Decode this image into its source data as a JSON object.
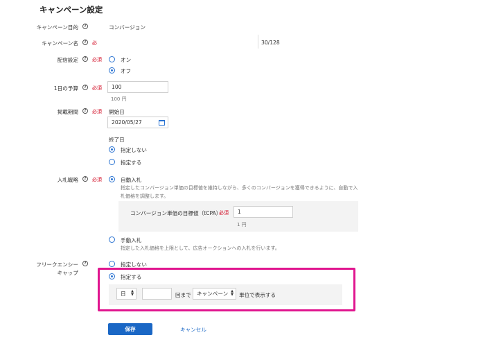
{
  "page_title": "キャンペーン設定",
  "required_label": "必須",
  "fields": {
    "objective": {
      "label": "キャンペーン目的",
      "value": "コンバージョン"
    },
    "name": {
      "label": "キャンペーン名",
      "required": "必",
      "counter": "30/128"
    },
    "delivery": {
      "label": "配信設定",
      "options": [
        "オン",
        "オフ"
      ],
      "selected": "オフ"
    },
    "daily_budget": {
      "label": "1日の予算",
      "value": "100",
      "hint": "100 円"
    },
    "period": {
      "label": "掲載期間",
      "start_label": "開始日",
      "start_value": "2020/05/27",
      "end_label": "終了日",
      "end_options": [
        "指定しない",
        "指定する"
      ],
      "end_selected": "指定しない"
    },
    "bidding": {
      "label": "入札戦略",
      "auto_label": "自動入札",
      "auto_desc_line1": "指定したコンバージョン単価の目標値を維持しながら、多くのコンバージョンを獲得できるように、自動で入",
      "auto_desc_line2": "札価格を調整します。",
      "tcpa_label": "コンバージョン単価の目標値（tCPA）",
      "tcpa_value": "1",
      "tcpa_hint": "1 円",
      "manual_label": "手動入札",
      "manual_desc": "指定した入札価格を上限として、広告オークションへの入札を行います。"
    },
    "frequency_cap": {
      "label_line1": "フリークエンシー",
      "label_line2": "キャップ",
      "options": [
        "指定しない",
        "指定する"
      ],
      "selected": "指定する",
      "unit_select": "日",
      "count_value": "",
      "middle_text": "回まで",
      "scope_select": "キャンペーン",
      "suffix_text": "単位で表示する"
    }
  },
  "actions": {
    "save_label": "保存",
    "cancel_label": "キャンセル"
  },
  "colors": {
    "accent": "#1a67c5",
    "required": "#d0021b",
    "highlight": "#e0168f"
  }
}
